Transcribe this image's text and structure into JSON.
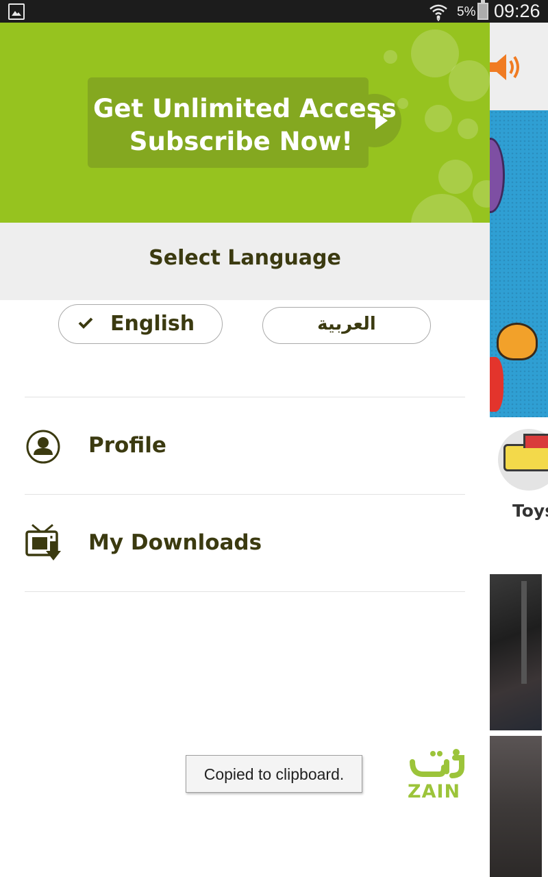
{
  "status_bar": {
    "battery_percent": "5%",
    "time": "09:26",
    "icons": [
      "gallery-icon",
      "wifi-icon",
      "battery-icon"
    ]
  },
  "drawer": {
    "promo": {
      "line1": "Get Unlimited Access",
      "line2": "Subscribe Now!"
    },
    "language": {
      "title": "Select Language",
      "options": [
        {
          "label": "English",
          "selected": true
        },
        {
          "label": "العربية",
          "selected": false
        }
      ]
    },
    "menu": [
      {
        "label": "Profile",
        "icon": "profile-icon"
      },
      {
        "label": "My Downloads",
        "icon": "downloads-tv-icon"
      }
    ],
    "logo": {
      "arabic": "زين",
      "latin": "ZAIN"
    }
  },
  "background_app": {
    "category_label": "Toys"
  },
  "toast": {
    "text": "Copied to clipboard."
  },
  "colors": {
    "brand_green": "#96c31f",
    "button_green": "#84a820",
    "text_dark": "#3b3a10",
    "zain_green": "#9cc43a"
  }
}
